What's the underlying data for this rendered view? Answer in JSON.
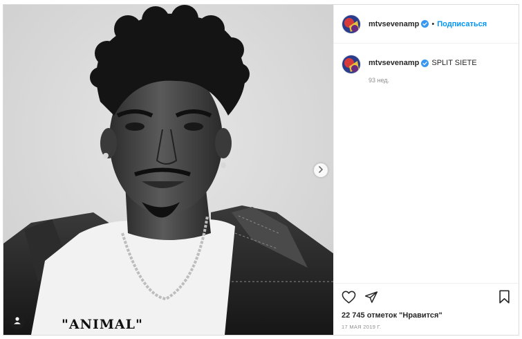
{
  "post": {
    "username": "mtvsevenamp",
    "follow_label": "Подписаться",
    "separator": "•",
    "caption": "SPLIT SIETE",
    "caption_time": "93 нед.",
    "likes": "22 745 отметок \"Нравится\"",
    "date": "17 МАЯ 2019 Г.",
    "shirt_print": "\"ANIMAL\""
  },
  "icons": {
    "verified": "verified-badge-icon",
    "next": "chevron-right-icon",
    "tag": "user-tag-icon",
    "like": "heart-icon",
    "share": "paper-plane-icon",
    "save": "bookmark-icon"
  },
  "colors": {
    "accent": "#0095f6",
    "verified": "#3897f0",
    "text": "#262626",
    "muted": "#8e8e8e",
    "border": "#dbdbdb"
  }
}
